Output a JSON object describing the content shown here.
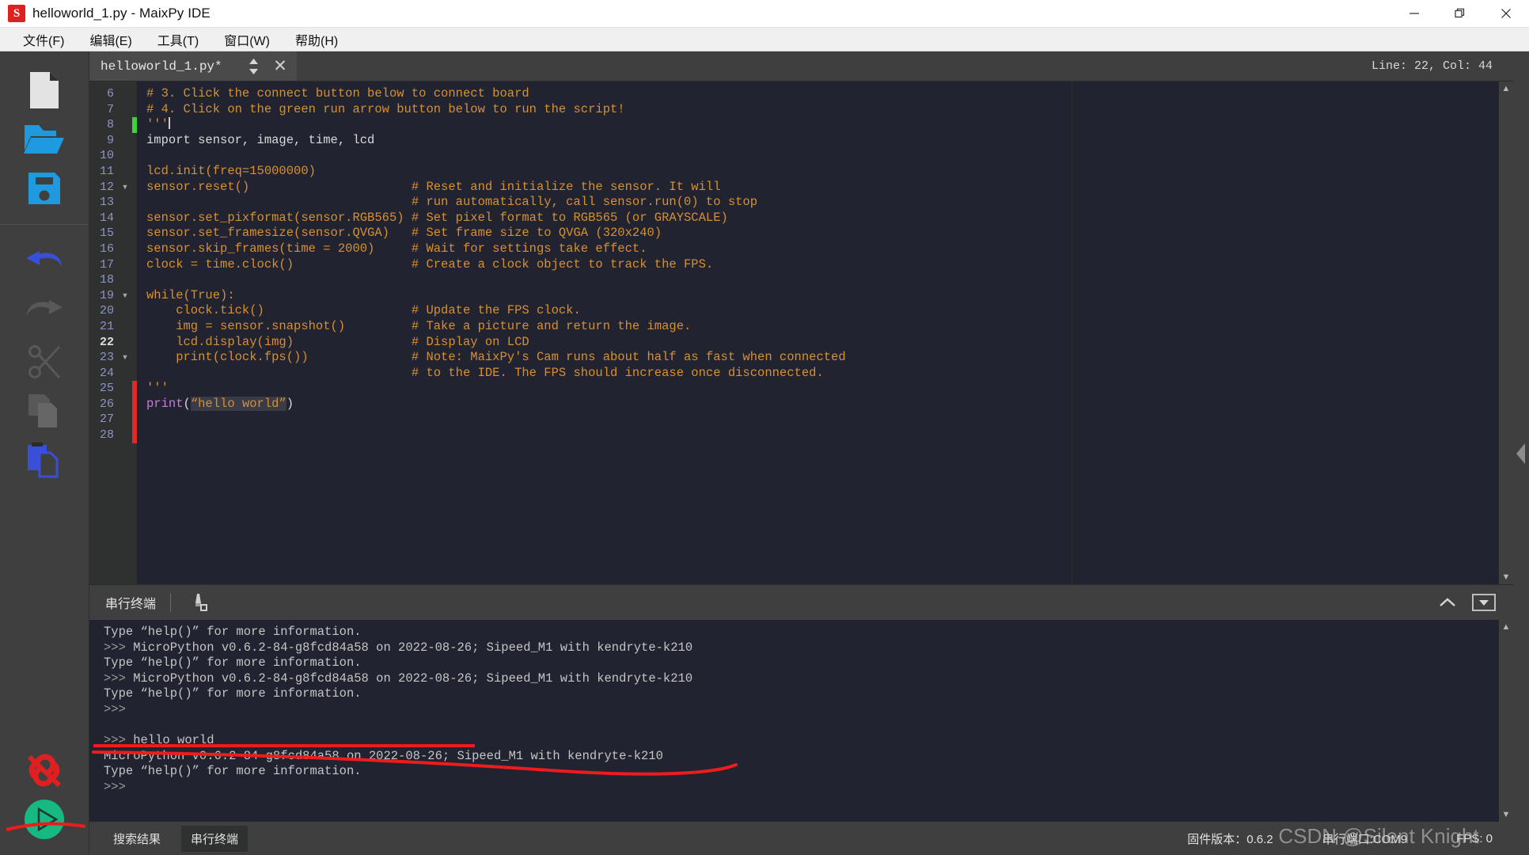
{
  "window": {
    "title": "helloworld_1.py - MaixPy IDE",
    "logo_text": "S",
    "controls": {
      "minimize": "—",
      "restore": "❐",
      "close": "✕"
    }
  },
  "menubar": {
    "items": [
      {
        "label": "文件(F)",
        "name": "menu-file"
      },
      {
        "label": "编辑(E)",
        "name": "menu-edit"
      },
      {
        "label": "工具(T)",
        "name": "menu-tools"
      },
      {
        "label": "窗口(W)",
        "name": "menu-window"
      },
      {
        "label": "帮助(H)",
        "name": "menu-help"
      }
    ]
  },
  "toolstrip": {
    "buttons": [
      {
        "name": "new-file-icon",
        "tip": "New File",
        "state": "enabled"
      },
      {
        "name": "open-folder-icon",
        "tip": "Open File",
        "state": "enabled"
      },
      {
        "name": "save-file-icon",
        "tip": "Save File",
        "state": "enabled"
      },
      {
        "name": "undo-icon",
        "tip": "Undo",
        "state": "enabled"
      },
      {
        "name": "redo-icon",
        "tip": "Redo",
        "state": "disabled"
      },
      {
        "name": "cut-icon",
        "tip": "Cut",
        "state": "disabled"
      },
      {
        "name": "copy-icon",
        "tip": "Copy",
        "state": "disabled"
      },
      {
        "name": "paste-icon",
        "tip": "Paste",
        "state": "enabled"
      },
      {
        "name": "disconnect-icon",
        "tip": "Disconnect",
        "state": "enabled"
      },
      {
        "name": "run-icon",
        "tip": "Run Script",
        "state": "enabled"
      }
    ]
  },
  "editor": {
    "tab": {
      "filename": "helloworld_1.py*",
      "close_glyph": "✕"
    },
    "cursor_status": "Line: 22, Col: 44",
    "first_line_number": 6,
    "current_line": 22,
    "lines": [
      {
        "n": 6,
        "fold": "",
        "mark": "",
        "segs": [
          {
            "t": "comment",
            "v": "# 3. Click the connect button below to connect board"
          }
        ]
      },
      {
        "n": 7,
        "fold": "",
        "mark": "",
        "segs": [
          {
            "t": "comment",
            "v": "# 4. Click on the green run arrow button below to run the script!"
          }
        ]
      },
      {
        "n": 8,
        "fold": "",
        "mark": "green",
        "segs": [
          {
            "t": "comment",
            "v": "'''"
          },
          {
            "t": "caret",
            "v": ""
          }
        ]
      },
      {
        "n": 9,
        "fold": "",
        "mark": "",
        "segs": [
          {
            "t": "plain",
            "v": "import sensor, image, time, lcd"
          }
        ]
      },
      {
        "n": 10,
        "fold": "",
        "mark": "",
        "segs": []
      },
      {
        "n": 11,
        "fold": "",
        "mark": "",
        "segs": [
          {
            "t": "comment",
            "v": "lcd.init(freq=15000000)"
          }
        ]
      },
      {
        "n": 12,
        "fold": "▼",
        "mark": "",
        "segs": [
          {
            "t": "comment",
            "v": "sensor.reset()                      # Reset and initialize the sensor. It will"
          }
        ]
      },
      {
        "n": 13,
        "fold": "",
        "mark": "",
        "segs": [
          {
            "t": "comment",
            "v": "                                    # run automatically, call sensor.run(0) to stop"
          }
        ]
      },
      {
        "n": 14,
        "fold": "",
        "mark": "",
        "segs": [
          {
            "t": "comment",
            "v": "sensor.set_pixformat(sensor.RGB565) # Set pixel format to RGB565 (or GRAYSCALE)"
          }
        ]
      },
      {
        "n": 15,
        "fold": "",
        "mark": "",
        "segs": [
          {
            "t": "comment",
            "v": "sensor.set_framesize(sensor.QVGA)   # Set frame size to QVGA (320x240)"
          }
        ]
      },
      {
        "n": 16,
        "fold": "",
        "mark": "",
        "segs": [
          {
            "t": "comment",
            "v": "sensor.skip_frames(time = 2000)     # Wait for settings take effect."
          }
        ]
      },
      {
        "n": 17,
        "fold": "",
        "mark": "",
        "segs": [
          {
            "t": "comment",
            "v": "clock = time.clock()                # Create a clock object to track the FPS."
          }
        ]
      },
      {
        "n": 18,
        "fold": "",
        "mark": "",
        "segs": []
      },
      {
        "n": 19,
        "fold": "▼",
        "mark": "",
        "segs": [
          {
            "t": "comment",
            "v": "while(True):"
          }
        ]
      },
      {
        "n": 20,
        "fold": "",
        "mark": "",
        "segs": [
          {
            "t": "comment",
            "v": "    clock.tick()                    # Update the FPS clock."
          }
        ]
      },
      {
        "n": 21,
        "fold": "",
        "mark": "",
        "segs": [
          {
            "t": "comment",
            "v": "    img = sensor.snapshot()         # Take a picture and return the image."
          }
        ]
      },
      {
        "n": 22,
        "fold": "",
        "mark": "",
        "segs": [
          {
            "t": "comment",
            "v": "    lcd.display(img)                # Display on LCD"
          }
        ]
      },
      {
        "n": 23,
        "fold": "▼",
        "mark": "",
        "segs": [
          {
            "t": "comment",
            "v": "    print(clock.fps())              # Note: MaixPy's Cam runs about half as fast when connected"
          }
        ]
      },
      {
        "n": 24,
        "fold": "",
        "mark": "",
        "segs": [
          {
            "t": "comment",
            "v": "                                    # to the IDE. The FPS should increase once disconnected."
          }
        ]
      },
      {
        "n": 25,
        "fold": "",
        "mark": "red",
        "segs": [
          {
            "t": "comment",
            "v": "'''"
          }
        ]
      },
      {
        "n": 26,
        "fold": "",
        "mark": "red",
        "segs": [
          {
            "t": "func",
            "v": "print"
          },
          {
            "t": "plain",
            "v": "("
          },
          {
            "t": "string",
            "v": "“hello world”"
          },
          {
            "t": "plain",
            "v": ")"
          }
        ]
      },
      {
        "n": 27,
        "fold": "",
        "mark": "red",
        "segs": []
      },
      {
        "n": 28,
        "fold": "",
        "mark": "red",
        "segs": []
      }
    ]
  },
  "terminal": {
    "title": "串行终端",
    "clear_icon": "clear-terminal-icon",
    "collapse_icon": "chevron-up-icon",
    "dropdown_icon": "chevron-down-box-icon",
    "lines": [
      "Type “help()” for more information.",
      ">>> MicroPython v0.6.2-84-g8fcd84a58 on 2022-08-26; Sipeed_M1 with kendryte-k210",
      "Type “help()” for more information.",
      ">>> MicroPython v0.6.2-84-g8fcd84a58 on 2022-08-26; Sipeed_M1 with kendryte-k210",
      "Type “help()” for more information.",
      ">>>",
      "",
      ">>> hello world",
      "MicroPython v0.6.2-84-g8fcd84a58 on 2022-08-26; Sipeed_M1 with kendryte-k210",
      "Type “help()” for more information.",
      ">>>"
    ]
  },
  "statusbar": {
    "tabs": [
      {
        "label": "搜索结果",
        "name": "statusbar-tab-search-results",
        "active": false
      },
      {
        "label": "串行终端",
        "name": "statusbar-tab-serial-terminal",
        "active": true
      }
    ],
    "firmware": "固件版本：0.6.2",
    "serial_port": "串行端口:COM9",
    "fps": "FPS: 0"
  },
  "watermark": {
    "text": "CSDN @Silent Knight"
  },
  "annotation": {
    "color": "#ee1c1c",
    "note": "hand-drawn red underline under hello world output"
  },
  "colors": {
    "accent_blue": "#1e9ae0",
    "undo_blue": "#3a4fd8",
    "run_green": "#17b982",
    "disconnect_red": "#e02020",
    "comment_orange": "#d79030",
    "editor_bg": "#212330",
    "panel_bg": "#3f3f3f"
  }
}
